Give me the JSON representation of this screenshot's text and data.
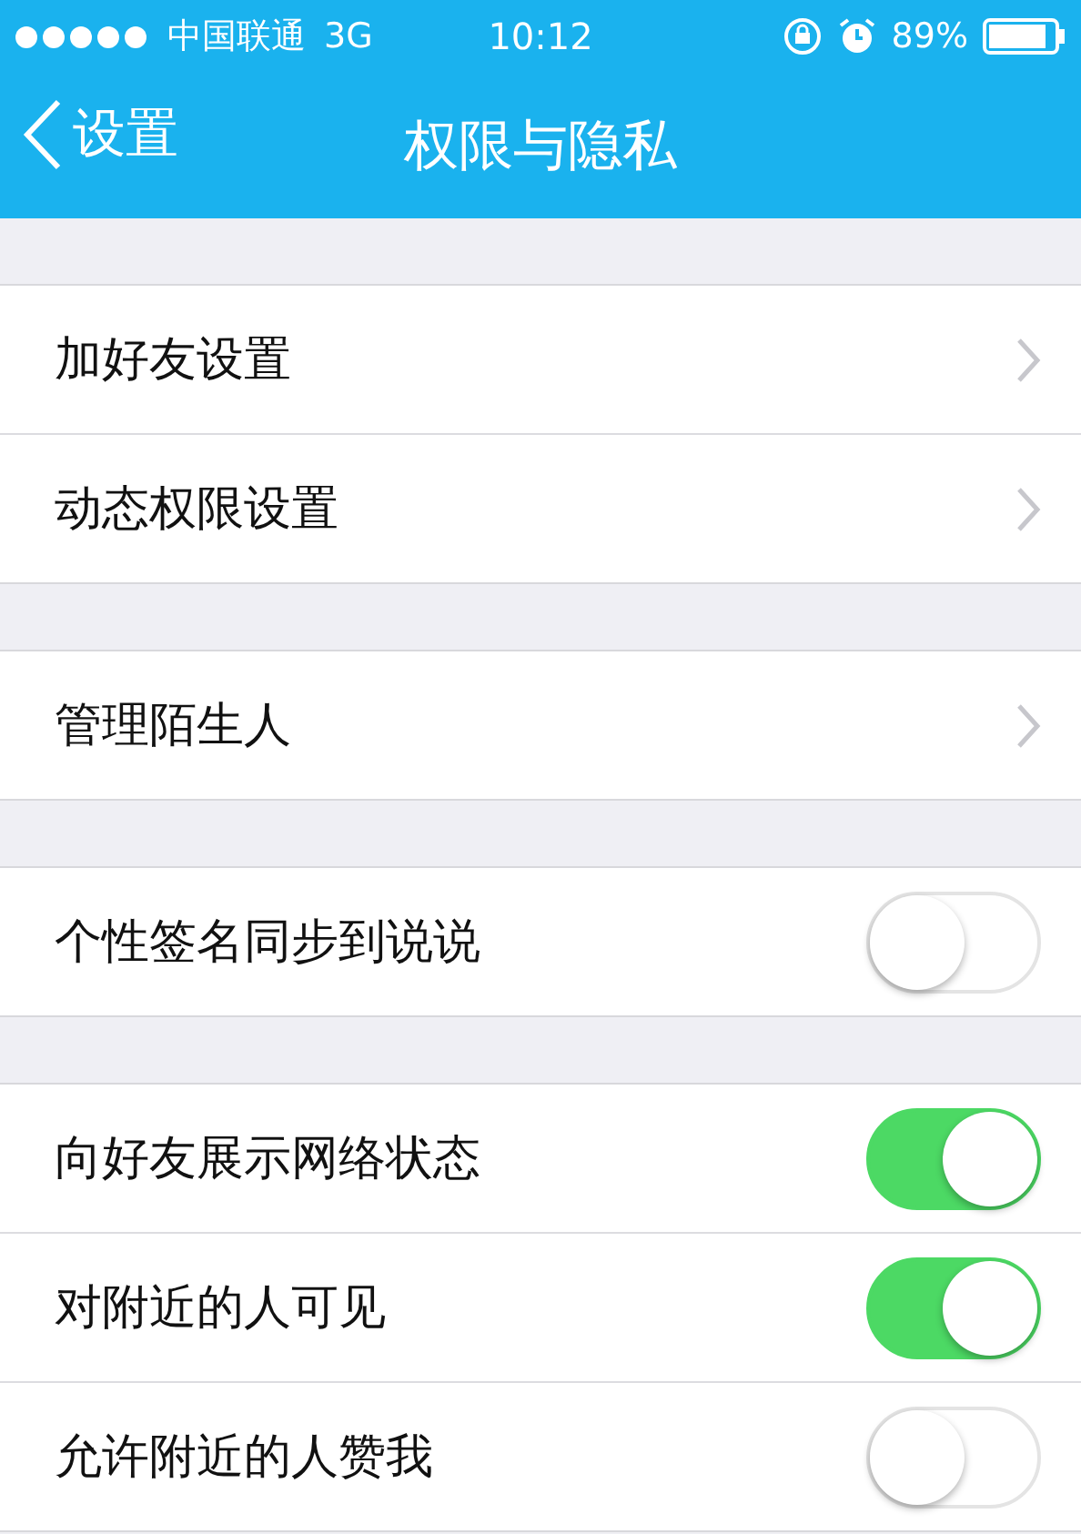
{
  "status_bar": {
    "carrier": "中国联通",
    "network": "3G",
    "time": "10:12",
    "battery": "89%"
  },
  "nav": {
    "back": "设置",
    "title": "权限与隐私"
  },
  "sections": [
    {
      "rows": [
        {
          "kind": "link",
          "label": "加好友设置"
        },
        {
          "kind": "link",
          "label": "动态权限设置"
        }
      ]
    },
    {
      "rows": [
        {
          "kind": "link",
          "label": "管理陌生人"
        }
      ]
    },
    {
      "rows": [
        {
          "kind": "toggle",
          "label": "个性签名同步到说说",
          "on": false
        }
      ]
    },
    {
      "rows": [
        {
          "kind": "toggle",
          "label": "向好友展示网络状态",
          "on": true
        },
        {
          "kind": "toggle",
          "label": "对附近的人可见",
          "on": true
        },
        {
          "kind": "toggle",
          "label": "允许附近的人赞我",
          "on": false
        }
      ]
    }
  ]
}
